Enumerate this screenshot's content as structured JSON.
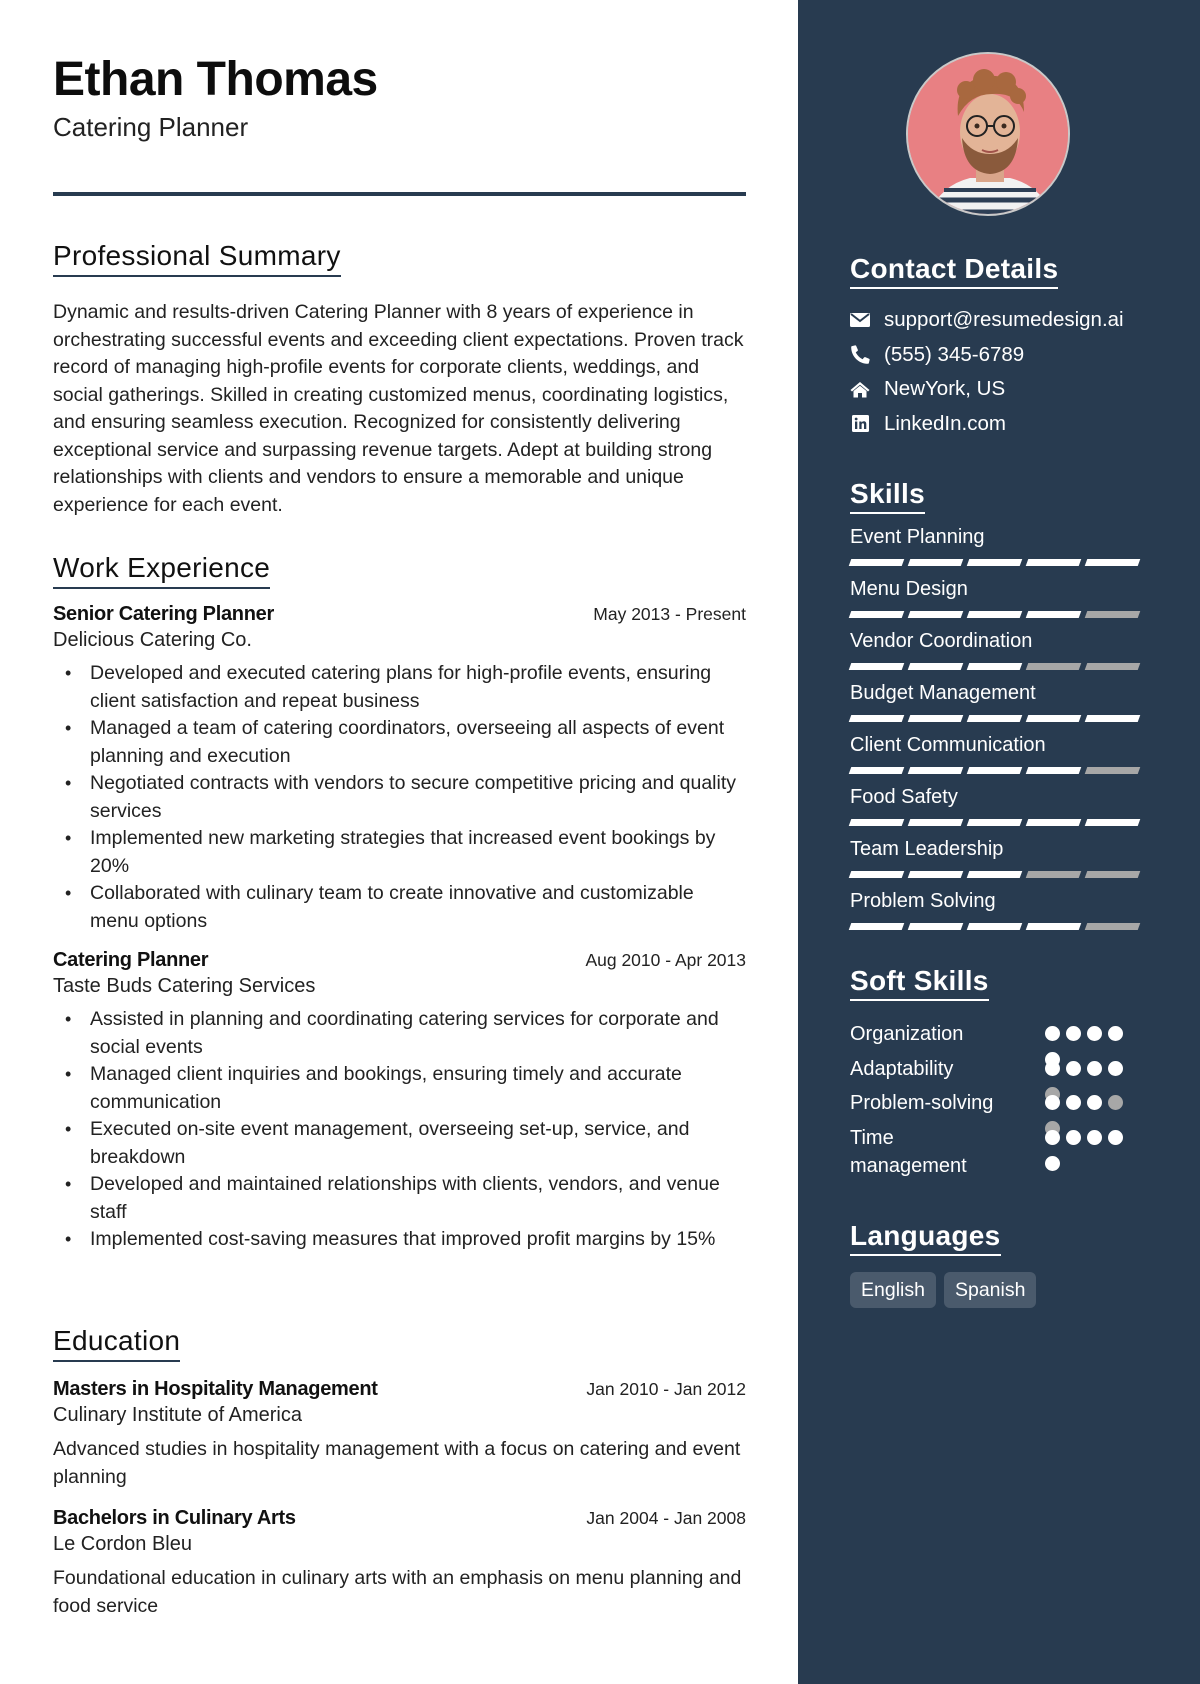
{
  "header": {
    "name": "Ethan Thomas",
    "title": "Catering Planner"
  },
  "summary": {
    "heading": "Professional Summary",
    "text": "Dynamic and results-driven Catering Planner with 8 years of experience in orchestrating successful events and exceeding client expectations. Proven track record of managing high-profile events for corporate clients, weddings, and social gatherings. Skilled in creating customized menus, coordinating logistics, and ensuring seamless execution. Recognized for consistently delivering exceptional service and surpassing revenue targets. Adept at building strong relationships with clients and vendors to ensure a memorable and unique experience for each event."
  },
  "work": {
    "heading": "Work Experience",
    "jobs": [
      {
        "title": "Senior Catering Planner",
        "dates": "May 2013 - Present",
        "company": "Delicious Catering Co.",
        "bullets": [
          "Developed and executed catering plans for high-profile events, ensuring client satisfaction and repeat business",
          "Managed a team of catering coordinators, overseeing all aspects of event planning and execution",
          "Negotiated contracts with vendors to secure competitive pricing and quality services",
          "Implemented new marketing strategies that increased event bookings by 20%",
          "Collaborated with culinary team to create innovative and customizable menu options"
        ]
      },
      {
        "title": "Catering Planner",
        "dates": "Aug 2010 - Apr 2013",
        "company": "Taste Buds Catering Services",
        "bullets": [
          "Assisted in planning and coordinating catering services for corporate and social events",
          "Managed client inquiries and bookings, ensuring timely and accurate communication",
          "Executed on-site event management, overseeing set-up, service, and breakdown",
          "Developed and maintained relationships with clients, vendors, and venue staff",
          "Implemented cost-saving measures that improved profit margins by 15%"
        ]
      }
    ]
  },
  "education": {
    "heading": "Education",
    "entries": [
      {
        "degree": "Masters in Hospitality Management",
        "dates": "Jan 2010 - Jan 2012",
        "school": "Culinary Institute of America",
        "description": "Advanced studies in hospitality management with a focus on catering and event planning"
      },
      {
        "degree": "Bachelors in Culinary Arts",
        "dates": "Jan 2004 - Jan 2008",
        "school": "Le Cordon Bleu",
        "description": "Foundational education in culinary arts with an emphasis on menu planning and food service"
      }
    ]
  },
  "sidebar": {
    "photo_alt": "profile-photo",
    "colors": {
      "background": "#283b50",
      "photo_bg": "#e88083",
      "bar_on": "#ffffff",
      "bar_off": "#a7a7a7",
      "badge": "#4a5a6c"
    },
    "contact": {
      "heading": "Contact Details",
      "items": [
        {
          "icon": "envelope-icon",
          "text": "support@resumedesign.ai"
        },
        {
          "icon": "phone-icon",
          "text": "(555) 345-6789"
        },
        {
          "icon": "home-icon",
          "text": "NewYork, US"
        },
        {
          "icon": "linkedin-icon",
          "text": "LinkedIn.com"
        }
      ]
    },
    "skills": {
      "heading": "Skills",
      "max": 5,
      "items": [
        {
          "name": "Event Planning",
          "level": 5
        },
        {
          "name": "Menu Design",
          "level": 4
        },
        {
          "name": "Vendor Coordination",
          "level": 3
        },
        {
          "name": "Budget Management",
          "level": 5
        },
        {
          "name": "Client Communication",
          "level": 4
        },
        {
          "name": "Food Safety",
          "level": 5
        },
        {
          "name": "Team Leadership",
          "level": 3
        },
        {
          "name": "Problem Solving",
          "level": 4
        }
      ]
    },
    "soft_skills": {
      "heading": "Soft Skills",
      "max": 5,
      "items": [
        {
          "name": "Organization",
          "level": 5
        },
        {
          "name": "Adaptability",
          "level": 4
        },
        {
          "name": "Problem-solving",
          "level": 3
        },
        {
          "name": "Time management",
          "level": 5
        }
      ]
    },
    "languages": {
      "heading": "Languages",
      "items": [
        "English",
        "Spanish"
      ]
    }
  }
}
